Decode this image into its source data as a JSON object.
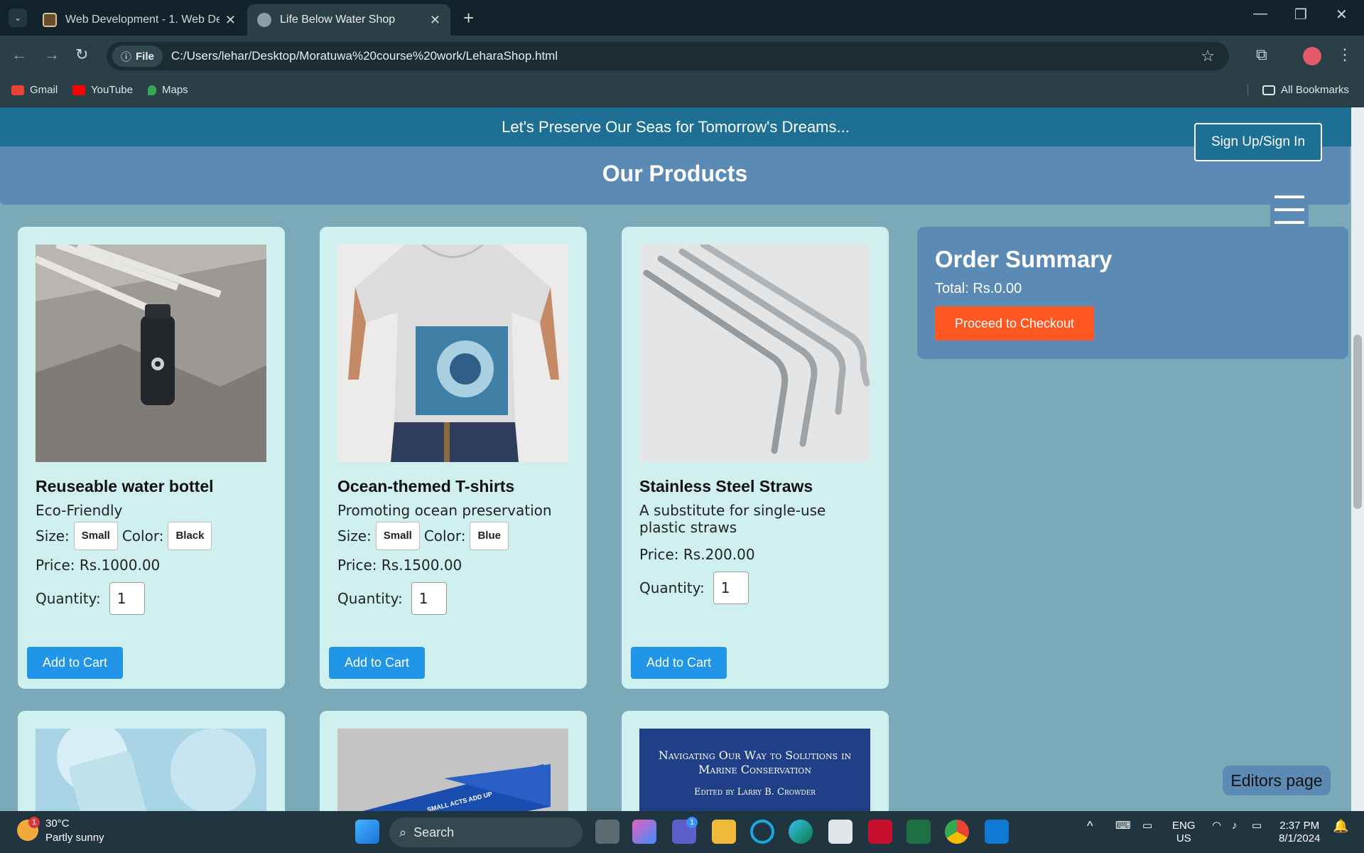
{
  "browser": {
    "tabs": [
      {
        "title": "Web Development - 1. Web De",
        "close": "✕"
      },
      {
        "title": "Life Below Water Shop",
        "close": "✕"
      }
    ],
    "new_tab": "+",
    "url_chip": "File",
    "url": "C:/Users/lehar/Desktop/Moratuwa%20course%20work/LeharaShop.html",
    "bookmarks": [
      {
        "label": "Gmail",
        "color": "#ea4335"
      },
      {
        "label": "YouTube",
        "color": "#ff0000"
      },
      {
        "label": "Maps",
        "color": "#34a853"
      }
    ],
    "all_bookmarks": "All Bookmarks"
  },
  "page": {
    "banner": "Let's Preserve Our Seas for Tomorrow's Dreams...",
    "sign_button": "Sign Up/Sign In",
    "products_title": "Our Products",
    "products": [
      {
        "name": "Reuseable water bottel",
        "desc": "Eco-Friendly",
        "size_label": "Size:",
        "size": "Small",
        "color_label": "Color:",
        "color": "Black",
        "price_label": "Price:",
        "price": "Rs.1000.00",
        "qty_label": "Quantity:",
        "qty": "1",
        "add": "Add to Cart"
      },
      {
        "name": "Ocean-themed T-shirts",
        "desc": "Promoting ocean preservation",
        "size_label": "Size:",
        "size": "Small",
        "color_label": "Color:",
        "color": "Blue",
        "price_label": "Price:",
        "price": "Rs.1500.00",
        "qty_label": "Quantity:",
        "qty": "1",
        "add": "Add to Cart"
      },
      {
        "name": "Stainless Steel Straws",
        "desc": "A substitute for single-use plastic straws",
        "price_label": "Price:",
        "price": "Rs.200.00",
        "qty_label": "Quantity:",
        "qty": "1",
        "add": "Add to Cart"
      }
    ],
    "book_cover_text": {
      "title": "Navigating Our Way to Solutions in Marine Conservation",
      "editor": "Edited by Larry B. Crowder"
    },
    "box_text": "SMALL ACTS ADD UP",
    "order_summary": {
      "title": "Order Summary",
      "total": "Total: Rs.0.00",
      "checkout": "Proceed to Checkout"
    },
    "editors": "Editors page",
    "colors": {
      "banner": "#1d6f93",
      "panel": "#5b8ab4",
      "card": "#d0f0f0",
      "accent": "#2196e8",
      "checkout": "#ff5722"
    }
  },
  "taskbar": {
    "temp": "30°C",
    "weather": "Partly sunny",
    "weather_badge": "1",
    "search": "Search",
    "teams_badge": "1",
    "lang1": "ENG",
    "lang2": "US",
    "time": "2:37 PM",
    "date": "8/1/2024"
  }
}
